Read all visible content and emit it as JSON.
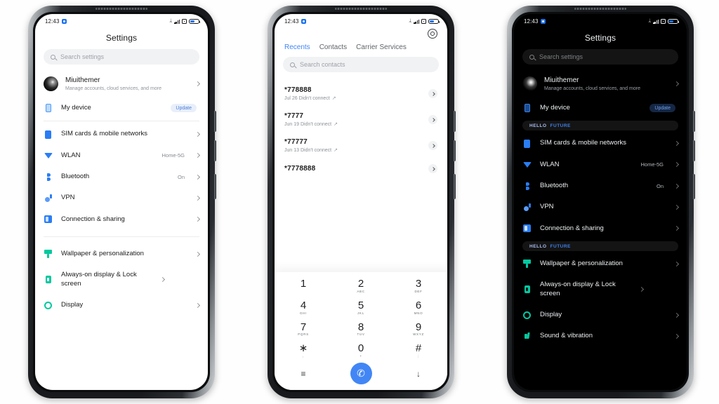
{
  "statusbar": {
    "time": "12:43",
    "icons": [
      "bluetooth-icon",
      "signal-icon",
      "vowifi-icon",
      "battery-icon"
    ],
    "bluetooth_glyph": "ᛦ"
  },
  "phone_light": {
    "title": "Settings",
    "search": {
      "placeholder": "Search settings",
      "icon": "search-icon"
    },
    "account": {
      "name": "Miuithemer",
      "subtitle": "Manage accounts, cloud services, and more"
    },
    "device": {
      "label": "My device",
      "badge": "Update"
    },
    "groups": [
      {
        "items": [
          {
            "label": "SIM cards & mobile networks",
            "value": "",
            "icon": "sim-icon"
          },
          {
            "label": "WLAN",
            "value": "Home-5G",
            "icon": "wifi-icon"
          },
          {
            "label": "Bluetooth",
            "value": "On",
            "icon": "bluetooth-icon"
          },
          {
            "label": "VPN",
            "value": "",
            "icon": "vpn-icon"
          },
          {
            "label": "Connection & sharing",
            "value": "",
            "icon": "connection-sharing-icon"
          }
        ]
      },
      {
        "items": [
          {
            "label": "Wallpaper & personalization",
            "value": "",
            "icon": "wallpaper-icon"
          },
          {
            "label": "Always-on display & Lock screen",
            "value": "",
            "icon": "always-on-display-icon"
          },
          {
            "label": "Display",
            "value": "",
            "icon": "display-icon"
          }
        ]
      }
    ]
  },
  "phone_dialer": {
    "gear": "settings-gear-icon",
    "tabs": [
      {
        "label": "Recents",
        "active": true
      },
      {
        "label": "Contacts",
        "active": false
      },
      {
        "label": "Carrier Services",
        "active": false
      }
    ],
    "search": {
      "placeholder": "Search contacts",
      "icon": "search-icon"
    },
    "calls": [
      {
        "number": "*778888",
        "meta": "Jul 26 Didn't connect"
      },
      {
        "number": "*7777",
        "meta": "Jun 19 Didn't connect"
      },
      {
        "number": "*77777",
        "meta": "Jun 13 Didn't connect"
      },
      {
        "number": "*7778888",
        "meta": ""
      }
    ],
    "keys": [
      {
        "digit": "1",
        "letters": ""
      },
      {
        "digit": "2",
        "letters": "ABC"
      },
      {
        "digit": "3",
        "letters": "DEF"
      },
      {
        "digit": "4",
        "letters": "GHI"
      },
      {
        "digit": "5",
        "letters": "JKL"
      },
      {
        "digit": "6",
        "letters": "MNO"
      },
      {
        "digit": "7",
        "letters": "PQRS"
      },
      {
        "digit": "8",
        "letters": "TUV"
      },
      {
        "digit": "9",
        "letters": "WXYZ"
      },
      {
        "digit": "∗",
        "letters": ","
      },
      {
        "digit": "0",
        "letters": "+"
      },
      {
        "digit": "#",
        "letters": ";"
      }
    ],
    "bottom": {
      "left_icon": "menu-icon",
      "left_glyph": "≡",
      "call_glyph": "✆",
      "right_icon": "hide-dialpad-icon",
      "right_glyph": "↓"
    }
  },
  "phone_dark": {
    "title": "Settings",
    "search": {
      "placeholder": "Search settings",
      "icon": "search-icon"
    },
    "account": {
      "name": "Miuithemer",
      "subtitle": "Manage accounts, cloud services, and more"
    },
    "device": {
      "label": "My device",
      "badge": "Update"
    },
    "banner": {
      "hello": "HELLO",
      "future": "FUTURE"
    },
    "groups": [
      {
        "items": [
          {
            "label": "SIM cards & mobile networks",
            "value": "",
            "icon": "sim-icon"
          },
          {
            "label": "WLAN",
            "value": "Home-5G",
            "icon": "wifi-icon"
          },
          {
            "label": "Bluetooth",
            "value": "On",
            "icon": "bluetooth-icon"
          },
          {
            "label": "VPN",
            "value": "",
            "icon": "vpn-icon"
          },
          {
            "label": "Connection & sharing",
            "value": "",
            "icon": "connection-sharing-icon"
          }
        ]
      },
      {
        "items": [
          {
            "label": "Wallpaper & personalization",
            "value": "",
            "icon": "wallpaper-icon"
          },
          {
            "label": "Always-on display & Lock screen",
            "value": "",
            "icon": "always-on-display-icon"
          },
          {
            "label": "Display",
            "value": "",
            "icon": "display-icon"
          },
          {
            "label": "Sound & vibration",
            "value": "",
            "icon": "sound-icon"
          }
        ]
      }
    ]
  },
  "colors": {
    "accent_blue": "#2a7df4",
    "tab_active": "#4286f5",
    "teal": "#05c8a0",
    "banner_future": "#3f7fe8",
    "banner_hello": "#a9bdf0"
  }
}
